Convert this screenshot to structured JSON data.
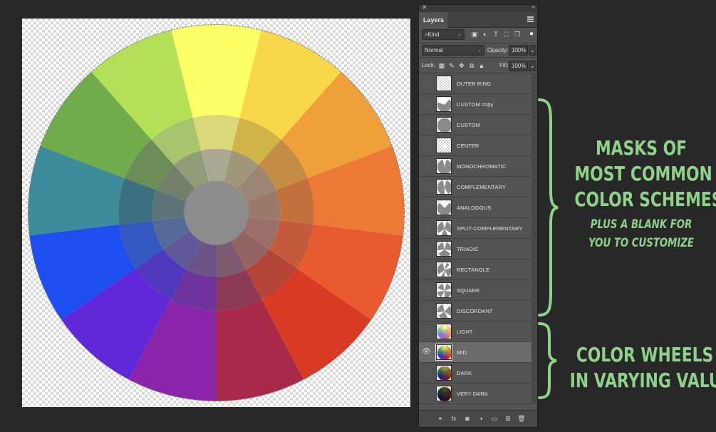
{
  "panel": {
    "tab_label": "Layers",
    "filter_kind": "Kind",
    "blend_mode": "Normal",
    "opacity_label": "Opacity:",
    "opacity_value": "100%",
    "lock_label": "Lock:",
    "fill_label": "Fill:",
    "fill_value": "100%"
  },
  "layers": [
    {
      "name": "OUTER RING",
      "visible": false,
      "thumb": "outer-ring"
    },
    {
      "name": "CUSTOM copy",
      "visible": false,
      "thumb": "custom-copy"
    },
    {
      "name": "CUSTOM",
      "visible": false,
      "thumb": "custom"
    },
    {
      "name": "CENTER",
      "visible": false,
      "thumb": "center"
    },
    {
      "name": "MONOCHROMATIC",
      "visible": false,
      "thumb": "mono"
    },
    {
      "name": "COMPLEMENTARY",
      "visible": false,
      "thumb": "comp"
    },
    {
      "name": "ANALOGOUS",
      "visible": false,
      "thumb": "analog"
    },
    {
      "name": "SPLIT-COMPLEMENTARY",
      "visible": false,
      "thumb": "split"
    },
    {
      "name": "TRIADIC",
      "visible": false,
      "thumb": "triad"
    },
    {
      "name": "RECTANGLE",
      "visible": false,
      "thumb": "rect"
    },
    {
      "name": "SQUARE",
      "visible": false,
      "thumb": "square"
    },
    {
      "name": "DISCORDANT",
      "visible": false,
      "thumb": "discord"
    },
    {
      "name": "LIGHT",
      "visible": false,
      "thumb": "wheel-light"
    },
    {
      "name": "MID",
      "visible": true,
      "selected": true,
      "thumb": "wheel-mid"
    },
    {
      "name": "DARK",
      "visible": false,
      "thumb": "wheel-dark"
    },
    {
      "name": "VERY DARK",
      "visible": false,
      "thumb": "wheel-verydark"
    }
  ],
  "annotations": {
    "masks_line1": "MASKS OF",
    "masks_line2": "MOST COMMON",
    "masks_line3": "COLOR SCHEMES",
    "masks_sub1": "PLUS A BLANK FOR",
    "masks_sub2": "YOU TO CUSTOMIZE",
    "wheels_line1": "COLOR WHEELS",
    "wheels_line2": "IN VARYING VALUES",
    "color": "#8fd28a"
  },
  "wheel": {
    "outer": [
      "#ffff66",
      "#f8d84a",
      "#f0a03a",
      "#ec7a36",
      "#e85a30",
      "#d83a24",
      "#a82a48",
      "#8a24a8",
      "#6028d8",
      "#1e4ef0",
      "#3c8c9c",
      "#70ac4c",
      "#b4e058"
    ],
    "middle": [
      "#dad878",
      "#d0b448",
      "#c48c44",
      "#c4703c",
      "#c45a3c",
      "#b44438",
      "#8c3a58",
      "#6c349c",
      "#5038bc",
      "#3458c0",
      "#3c7080",
      "#6c8c58",
      "#a8c46c"
    ],
    "inner": [
      "#aaa892",
      "#a09678",
      "#9a8672",
      "#9c7a6a",
      "#9c706a",
      "#946464",
      "#7c5a70",
      "#6c5488",
      "#605898",
      "#566a98",
      "#5c7478",
      "#70806a",
      "#909c78"
    ],
    "center": "#8c8c8c"
  }
}
